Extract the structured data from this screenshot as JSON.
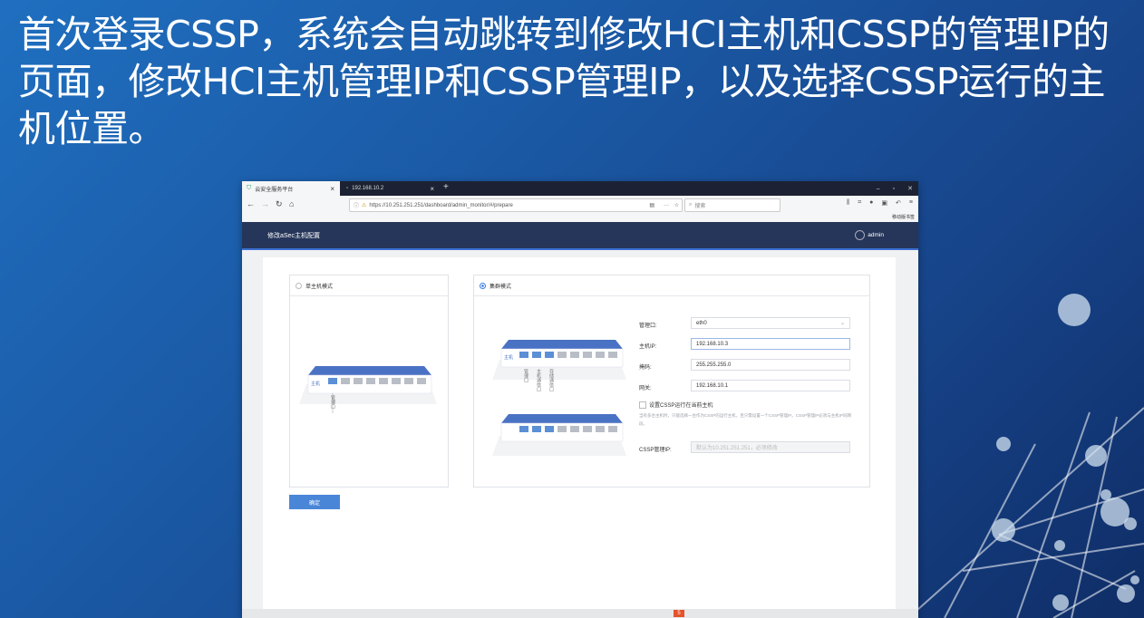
{
  "headline": "首次登录CSSP，系统会自动跳转到修改HCI主机和CSSP的管理IP的页面，修改HCI主机管理IP和CSSP管理IP，以及选择CSSP运行的主机位置。",
  "browser": {
    "tabs": [
      {
        "label": "云安全服务平台"
      },
      {
        "label": "192.168.10.2"
      }
    ],
    "new_tab": "+",
    "url": "https://10.251.251.251/dashboard/admin_monitor/#/prepare",
    "search_placeholder": "搜索",
    "mobile_bookmarks": "移动版书签"
  },
  "app": {
    "title": "修改aSec主机配置",
    "user": "admin"
  },
  "single_mode": {
    "label": "单主机模式",
    "switch_label": "主机",
    "ports": [
      "①",
      "②",
      "③",
      "④",
      "⑤",
      "⑥",
      "⑦",
      "⑧"
    ],
    "port_note": "管理口"
  },
  "cluster_mode": {
    "label": "集群模式",
    "switch_label": "主机",
    "ports": [
      "①",
      "②",
      "③",
      "④",
      "⑤",
      "⑥",
      "⑦",
      "⑧"
    ],
    "notes": [
      "管理口",
      "主机通信口",
      "存储通信口"
    ],
    "form": {
      "mgmt_port_label": "管理口:",
      "mgmt_port_value": "eth0",
      "host_ip_label": "主机IP:",
      "host_ip_value": "192.168.10.3",
      "mask_label": "掩码:",
      "mask_value": "255.255.255.0",
      "gateway_label": "网关:",
      "gateway_value": "192.168.10.1",
      "run_here_label": "设置CSSP运行在当前主机",
      "hint": "当有多台主机时，只能选择一台作为CSSP的运行主机，且只需设置一个CSSP管理IP。CSSP管理IP必须与主机IP同网段。",
      "cssp_ip_label": "CSSP管理IP:",
      "cssp_ip_placeholder": "默认为10.251.251.251，必须修改"
    }
  },
  "confirm_button": "确定",
  "colors": {
    "background": "#1b5aa6",
    "app_header": "#26365a",
    "accent": "#4a86d8",
    "switch_top": "#4a72c4"
  }
}
